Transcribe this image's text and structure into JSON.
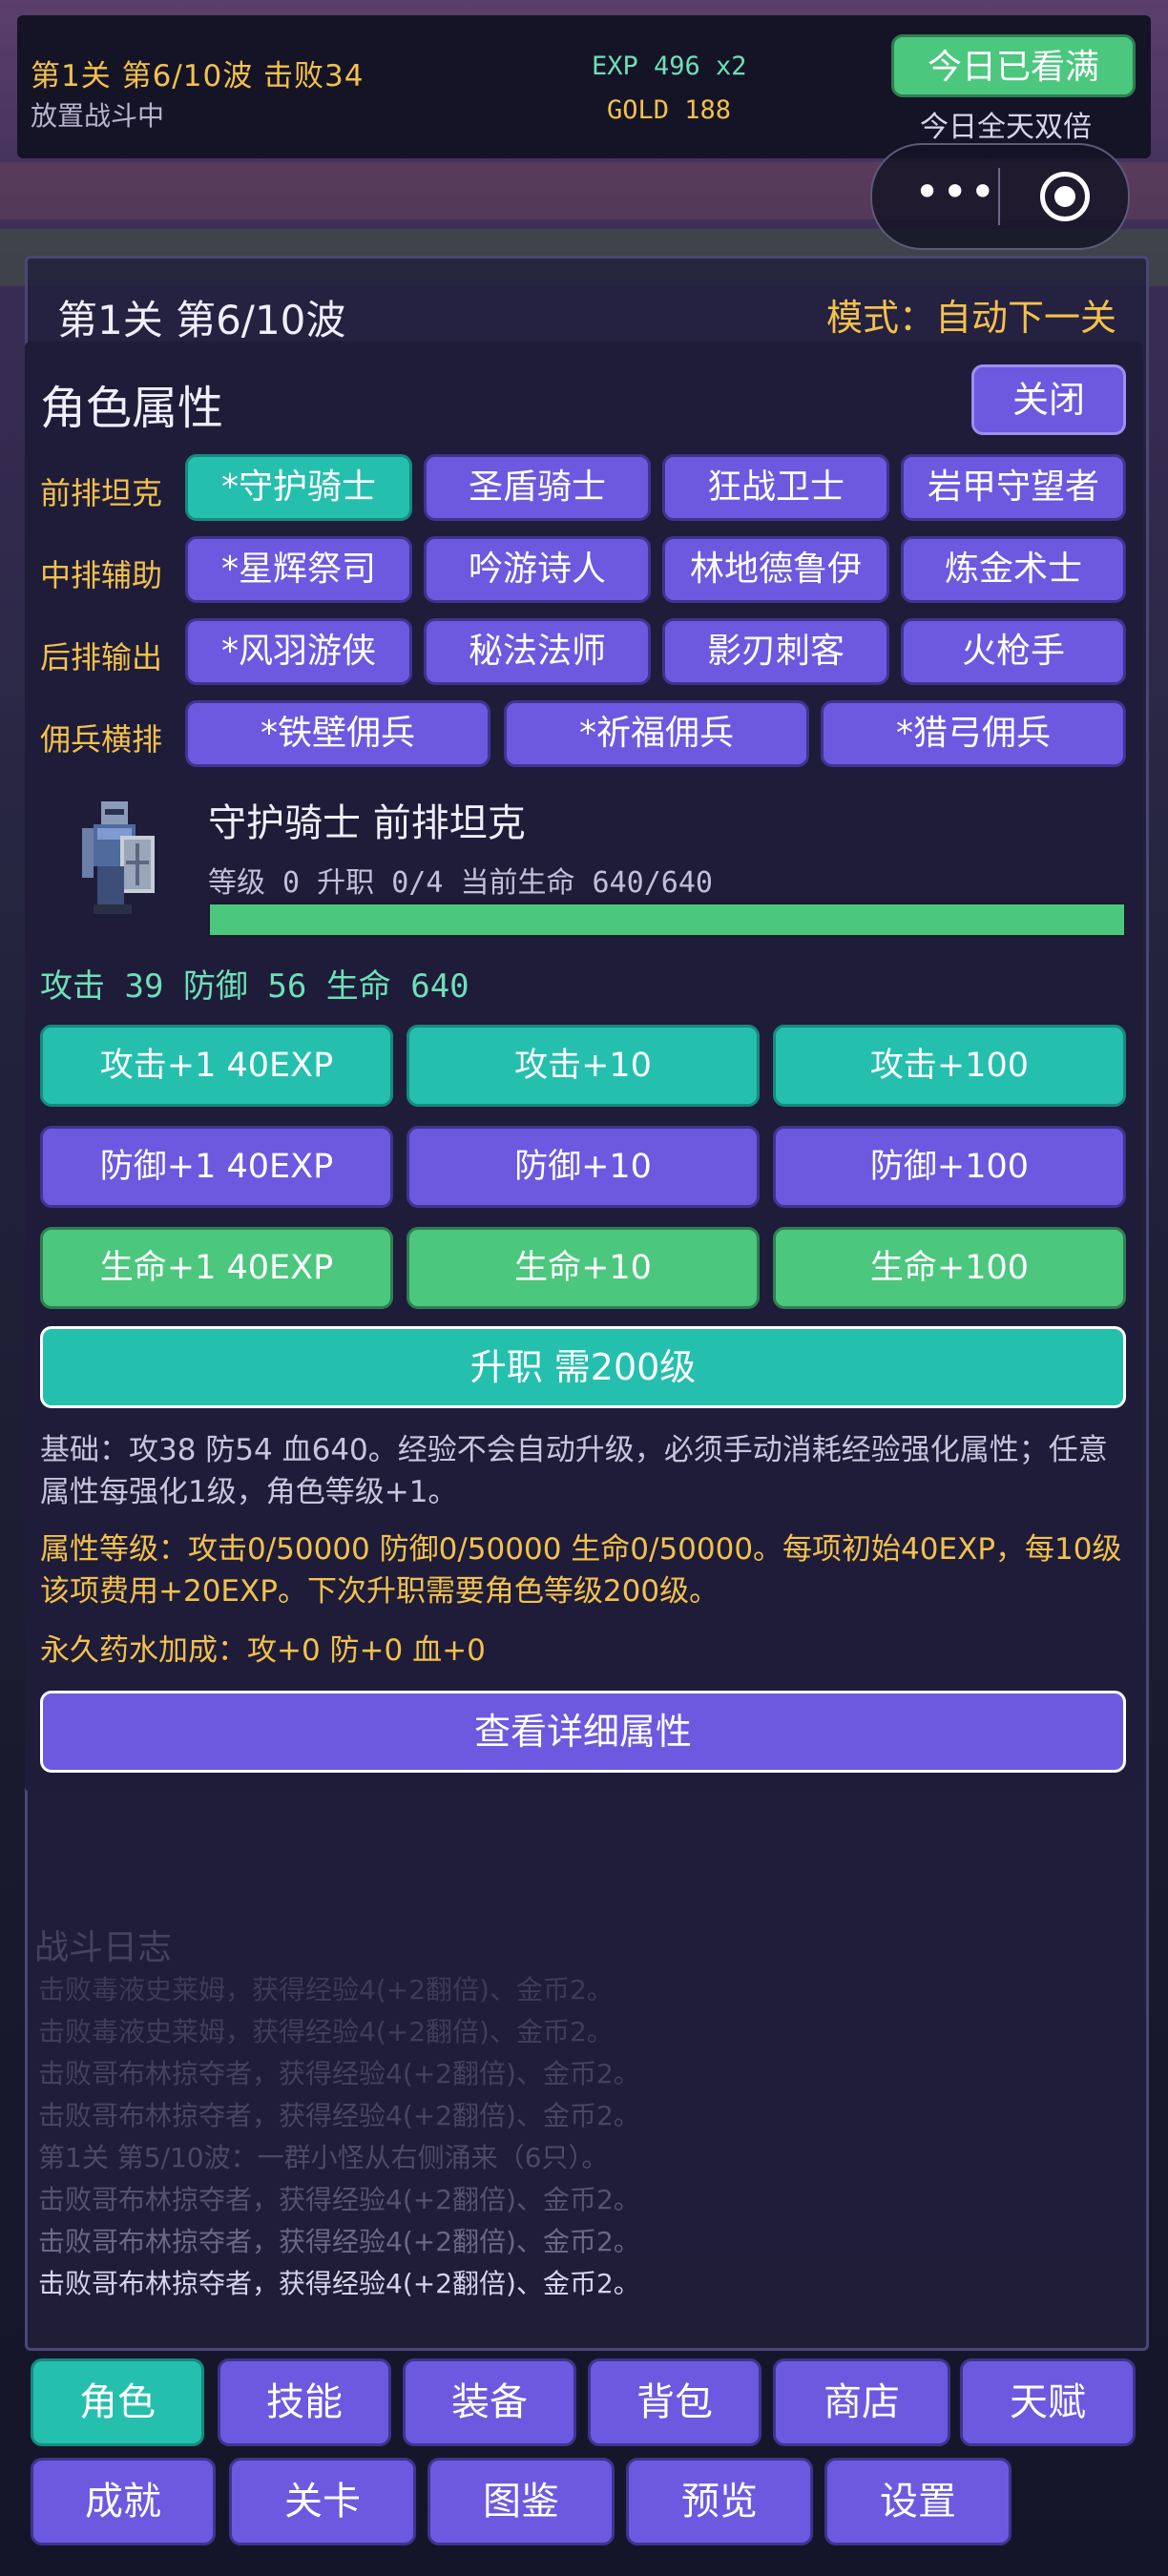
{
  "header": {
    "progress": "第1关 第6/10波  击败34",
    "status": "放置战斗中",
    "exp": "EXP 496 x2",
    "gold": "GOLD 188",
    "watched_button": "今日已看满",
    "double_text": "今日全天双倍"
  },
  "capsule": {
    "more_icon": "more-dots-icon",
    "close_icon": "target-icon"
  },
  "stage_panel": {
    "stage": "第1关 第6/10波",
    "mode": "模式：自动下一关"
  },
  "modal": {
    "title": "角色属性",
    "close": "关闭",
    "rows": [
      {
        "label": "前排坦克",
        "roles": [
          "*守护骑士",
          "圣盾骑士",
          "狂战卫士",
          "岩甲守望者"
        ],
        "active": 0
      },
      {
        "label": "中排辅助",
        "roles": [
          "*星辉祭司",
          "吟游诗人",
          "林地德鲁伊",
          "炼金术士"
        ]
      },
      {
        "label": "后排输出",
        "roles": [
          "*风羽游侠",
          "秘法法师",
          "影刃刺客",
          "火枪手"
        ]
      },
      {
        "label": "佣兵横排",
        "roles": [
          "*铁壁佣兵",
          "*祈福佣兵",
          "*猎弓佣兵"
        ]
      }
    ],
    "character": {
      "name": "守护骑士   前排坦克",
      "sub": "等级 0   升职 0/4   当前生命 640/640",
      "hp_fraction": 1.0,
      "stats": "攻击 39   防御 56   生命 640"
    },
    "upgrades": {
      "atk": [
        "攻击+1 40EXP",
        "攻击+10",
        "攻击+100"
      ],
      "def": [
        "防御+1 40EXP",
        "防御+10",
        "防御+100"
      ],
      "hp": [
        "生命+1 40EXP",
        "生命+10",
        "生命+100"
      ]
    },
    "promote": "升职 需200级",
    "info_base": "基础：攻38 防54 血640。经验不会自动升级，必须手动消耗经验强化属性；任意属性每强化1级，角色等级+1。",
    "info_levels": "属性等级：攻击0/50000 防御0/50000 生命0/50000。每项初始40EXP，每10级该项费用+20EXP。下次升职需要角色等级200级。",
    "potion": "永久药水加成：攻+0 防+0 血+0",
    "detail_button": "查看详细属性"
  },
  "log": {
    "title": "战斗日志",
    "lines": [
      "击败毒液史莱姆，获得经验4(+2翻倍)、金币2。",
      "击败毒液史莱姆，获得经验4(+2翻倍)、金币2。",
      "击败哥布林掠夺者，获得经验4(+2翻倍)、金币2。",
      "击败哥布林掠夺者，获得经验4(+2翻倍)、金币2。",
      "第1关 第5/10波：一群小怪从右侧涌来（6只）。",
      "击败哥布林掠夺者，获得经验4(+2翻倍)、金币2。",
      "击败哥布林掠夺者，获得经验4(+2翻倍)、金币2。",
      "击败哥布林掠夺者，获得经验4(+2翻倍)、金币2。"
    ]
  },
  "nav": {
    "row1": [
      "角色",
      "技能",
      "装备",
      "背包",
      "商店",
      "天赋"
    ],
    "row2": [
      "成就",
      "关卡",
      "图鉴",
      "预览",
      "设置"
    ]
  }
}
